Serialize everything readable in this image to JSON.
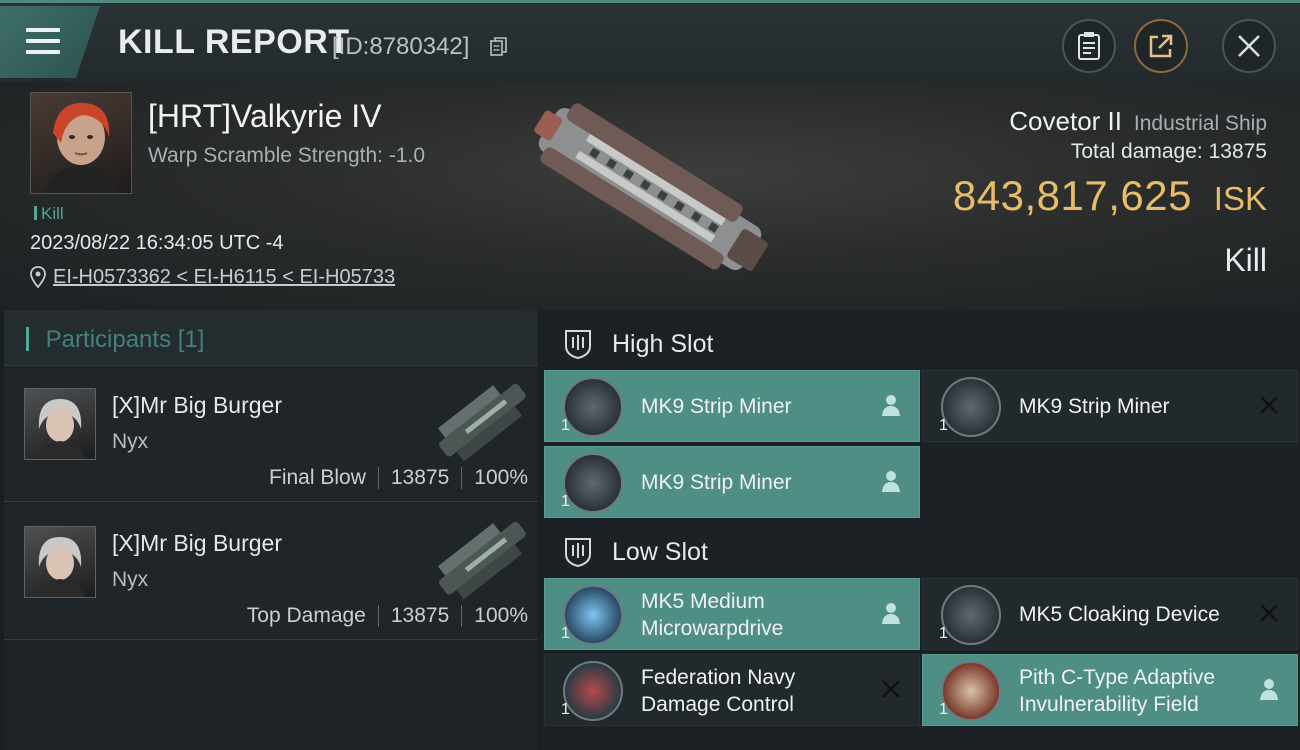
{
  "header": {
    "title": "KILL REPORT",
    "report_id": "[ID:8780342]"
  },
  "victim": {
    "name": "[HRT]Valkyrie IV",
    "warp_scramble": "Warp Scramble Strength: -1.0",
    "kill_tag": "Kill",
    "datetime": "2023/08/22 16:34:05 UTC -4",
    "location": "EI-H0573362 < EI-H6115 < EI-H05733",
    "ship_name": "Covetor II",
    "ship_class": "Industrial Ship",
    "total_damage_label": "Total damage:",
    "total_damage": "13875",
    "isk_value": "843,817,625",
    "isk_unit": "ISK",
    "status": "Kill"
  },
  "participants": {
    "title": "Participants",
    "count": "[1]",
    "items": [
      {
        "name": "[X]Mr Big Burger",
        "ship": "Nyx",
        "role": "Final Blow",
        "damage": "13875",
        "percent": "100%"
      },
      {
        "name": "[X]Mr Big Burger",
        "ship": "Nyx",
        "role": "Top Damage",
        "damage": "13875",
        "percent": "100%"
      }
    ]
  },
  "slots": {
    "high": {
      "label": "High Slot",
      "modules": [
        {
          "name_line1": "MK9 Strip Miner",
          "name_line2": "",
          "qty": "1",
          "status": "dropped",
          "icon": "strip-miner-icon"
        },
        {
          "name_line1": "MK9 Strip Miner",
          "name_line2": "",
          "qty": "1",
          "status": "destroyed",
          "icon": "strip-miner-icon"
        },
        {
          "name_line1": "MK9 Strip Miner",
          "name_line2": "",
          "qty": "1",
          "status": "dropped",
          "icon": "strip-miner-icon"
        }
      ]
    },
    "low": {
      "label": "Low Slot",
      "modules": [
        {
          "name_line1": "MK5 Medium",
          "name_line2": "Microwarpdrive",
          "qty": "1",
          "status": "dropped",
          "icon": "microwarpdrive-icon"
        },
        {
          "name_line1": "MK5 Cloaking Device",
          "name_line2": "",
          "qty": "1",
          "status": "destroyed",
          "icon": "cloaking-device-icon"
        },
        {
          "name_line1": "Federation Navy",
          "name_line2": "Damage Control",
          "qty": "1",
          "status": "destroyed",
          "icon": "damage-control-icon"
        },
        {
          "name_line1": "Pith C-Type Adaptive",
          "name_line2": "Invulnerability Field",
          "qty": "1",
          "status": "dropped",
          "icon": "invulnerability-field-icon"
        }
      ]
    }
  },
  "colors": {
    "accent": "#4f8e85",
    "isk": "#e8bd6a",
    "teal_text": "#43817a"
  }
}
